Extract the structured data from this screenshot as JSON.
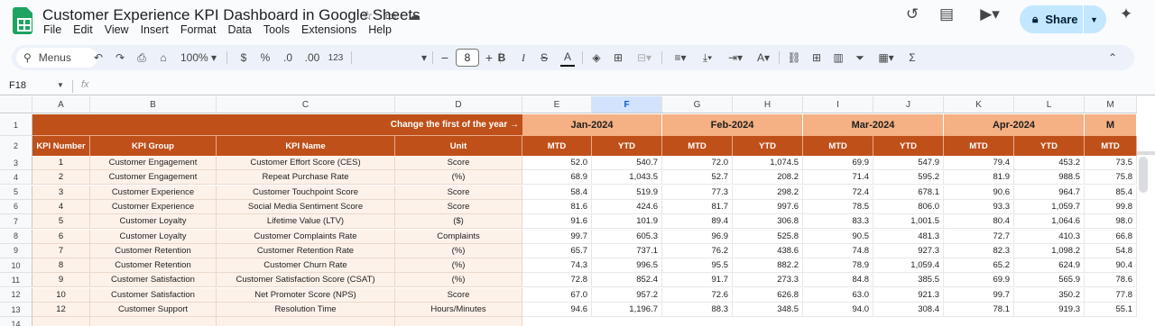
{
  "app": {
    "doc_title": "Customer Experience KPI Dashboard in Google Sheets",
    "menu": [
      "File",
      "Edit",
      "View",
      "Insert",
      "Format",
      "Data",
      "Tools",
      "Extensions",
      "Help"
    ],
    "share_label": "Share"
  },
  "toolbar": {
    "menus_label": "Menus",
    "zoom": "100%",
    "currency": "$",
    "percent": "%",
    "dec_decrease": ".0",
    "dec_increase": ".00",
    "number_format": "123",
    "font_size": "8"
  },
  "formula_bar": {
    "name_box": "F18",
    "fx": "fx"
  },
  "sheet": {
    "column_letters": [
      "A",
      "B",
      "C",
      "D",
      "E",
      "F",
      "G",
      "H",
      "I",
      "J",
      "K",
      "L",
      "M"
    ],
    "selected_column": "F",
    "row_numbers": [
      "1",
      "2",
      "3",
      "4",
      "5",
      "6",
      "7",
      "8",
      "9",
      "10",
      "11",
      "12",
      "13",
      "14"
    ],
    "change_label": "Change the first of the year →",
    "months": [
      "Jan-2024",
      "Feb-2024",
      "Mar-2024",
      "Apr-2024",
      "M"
    ],
    "headers": [
      "KPI Number",
      "KPI Group",
      "KPI Name",
      "Unit"
    ],
    "mtd": "MTD",
    "ytd": "YTD",
    "rows": [
      {
        "num": "1",
        "group": "Customer Engagement",
        "name": "Customer Effort Score (CES)",
        "unit": "Score",
        "vals": [
          "52.0",
          "540.7",
          "72.0",
          "1,074.5",
          "69.9",
          "547.9",
          "79.4",
          "453.2",
          "73.5"
        ]
      },
      {
        "num": "2",
        "group": "Customer Engagement",
        "name": "Repeat Purchase Rate",
        "unit": "(%)",
        "vals": [
          "68.9",
          "1,043.5",
          "52.7",
          "208.2",
          "71.4",
          "595.2",
          "81.9",
          "988.5",
          "75.8"
        ]
      },
      {
        "num": "3",
        "group": "Customer Experience",
        "name": "Customer Touchpoint Score",
        "unit": "Score",
        "vals": [
          "58.4",
          "519.9",
          "77.3",
          "298.2",
          "72.4",
          "678.1",
          "90.6",
          "964.7",
          "85.4"
        ]
      },
      {
        "num": "4",
        "group": "Customer Experience",
        "name": "Social Media Sentiment Score",
        "unit": "Score",
        "vals": [
          "81.6",
          "424.6",
          "81.7",
          "997.6",
          "78.5",
          "806.0",
          "93.3",
          "1,059.7",
          "99.8"
        ]
      },
      {
        "num": "5",
        "group": "Customer Loyalty",
        "name": "Lifetime Value (LTV)",
        "unit": "($)",
        "vals": [
          "91.6",
          "101.9",
          "89.4",
          "306.8",
          "83.3",
          "1,001.5",
          "80.4",
          "1,064.6",
          "98.0"
        ]
      },
      {
        "num": "6",
        "group": "Customer Loyalty",
        "name": "Customer Complaints Rate",
        "unit": "Complaints",
        "vals": [
          "99.7",
          "605.3",
          "96.9",
          "525.8",
          "90.5",
          "481.3",
          "72.7",
          "410.3",
          "66.8"
        ]
      },
      {
        "num": "7",
        "group": "Customer Retention",
        "name": "Customer Retention Rate",
        "unit": "(%)",
        "vals": [
          "65.7",
          "737.1",
          "76.2",
          "438.6",
          "74.8",
          "927.3",
          "82.3",
          "1,098.2",
          "54.8"
        ]
      },
      {
        "num": "8",
        "group": "Customer Retention",
        "name": "Customer Churn Rate",
        "unit": "(%)",
        "vals": [
          "74.3",
          "996.5",
          "95.5",
          "882.2",
          "78.9",
          "1,059.4",
          "65.2",
          "624.9",
          "90.4"
        ]
      },
      {
        "num": "9",
        "group": "Customer Satisfaction",
        "name": "Customer Satisfaction Score (CSAT)",
        "unit": "(%)",
        "vals": [
          "72.8",
          "852.4",
          "91.7",
          "273.3",
          "84.8",
          "385.5",
          "69.9",
          "565.9",
          "78.6"
        ]
      },
      {
        "num": "10",
        "group": "Customer Satisfaction",
        "name": "Net Promoter Score (NPS)",
        "unit": "Score",
        "vals": [
          "67.0",
          "957.2",
          "72.6",
          "626.8",
          "63.0",
          "921.3",
          "99.7",
          "350.2",
          "77.8"
        ]
      },
      {
        "num": "12",
        "group": "Customer Support",
        "name": "Resolution Time",
        "unit": "Hours/Minutes",
        "vals": [
          "94.6",
          "1,196.7",
          "88.3",
          "348.5",
          "94.0",
          "308.4",
          "78.1",
          "919.3",
          "55.1"
        ]
      }
    ]
  }
}
